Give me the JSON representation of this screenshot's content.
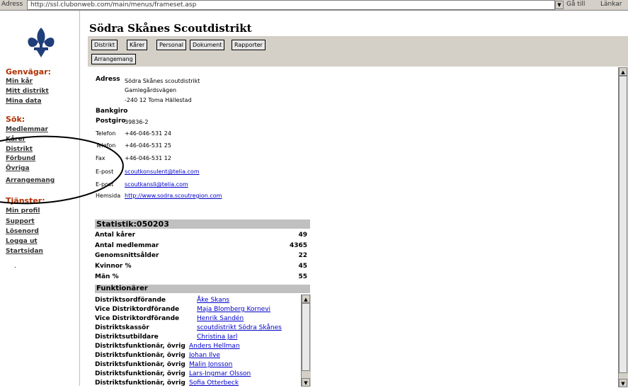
{
  "browser": {
    "address_label": "Adress",
    "url": "http://ssl.clubonweb.com/main/menus/frameset.asp",
    "go_label": "Gå till",
    "links_label": "Länkar"
  },
  "nav": {
    "shortcuts_heading": "Genvägar:",
    "shortcuts": [
      "Min kår",
      "Mitt distrikt",
      "Mina data"
    ],
    "search_heading": "Sök:",
    "search": [
      "Medlemmar",
      "Kårer",
      "Distrikt",
      "Förbund",
      "Övriga",
      "Arrangemang"
    ],
    "services_heading": "Tjänster:",
    "services": [
      "Min profil",
      "Support",
      "Lösenord",
      "Logga ut",
      "Startsidan"
    ],
    "bullet": "."
  },
  "header": {
    "title": "Södra Skånes Scoutdistrikt",
    "tabs": [
      "Distrikt",
      "Kårer",
      "Personal",
      "Dokument",
      "Rapporter",
      "Arrangemang"
    ]
  },
  "contact": {
    "address_label": "Adress",
    "address_lines": [
      "Södra Skånes scoutdistrikt",
      "Gamlegårdsvägen",
      "-240 12 Toma Hällestad"
    ],
    "bankgiro_label": "Bankgiro",
    "postgiro_label": "Postgiro",
    "postgiro_value": "39836-2",
    "phone_label": "Telefon",
    "phone1": "+46-046-531 24",
    "phone2": "+46-046-531 25",
    "fax_label": "Fax",
    "fax": "+46-046-531 12",
    "email_label": "E-post",
    "email1": "scoutkonsulent@telia.com",
    "email2": "scoutkansli@telia.com",
    "homepage_label": "Hemsida",
    "homepage": "http://www.sodra.scoutregion.com"
  },
  "statistics": {
    "heading": "Statistik:050203",
    "rows": [
      {
        "label": "Antal kårer",
        "value": "49"
      },
      {
        "label": "Antal medlemmar",
        "value": "4365"
      },
      {
        "label": "Genomsnittsålder",
        "value": "22"
      },
      {
        "label": "Kvinnor %",
        "value": "45"
      },
      {
        "label": "Män %",
        "value": "55"
      }
    ]
  },
  "officials": {
    "heading": "Funktionärer",
    "rows": [
      {
        "role": "Distriktsordförande",
        "name": "Åke Skans"
      },
      {
        "role": "Vice Distriktordförande",
        "name": "Maja Blomberg Kornevi"
      },
      {
        "role": "Vice Distriktordförande",
        "name": "Henrik Sandén"
      },
      {
        "role": "Distriktskassör",
        "name": "scoutdistrikt Södra Skånes"
      },
      {
        "role": "Distriktsutbildare",
        "name": "Christina Jarl"
      },
      {
        "role": "Distriktsfunktionär, övrig",
        "name": "Anders Hellman"
      },
      {
        "role": "Distriktsfunktionär, övrig",
        "name": "Johan Ilve"
      },
      {
        "role": "Distriktsfunktionär, övrig",
        "name": "Malin Jonsson"
      },
      {
        "role": "Distriktsfunktionär, övrig",
        "name": "Lars-Ingmar Olsson"
      },
      {
        "role": "Distriktsfunktionär, övrig",
        "name": "Sofia Otterbeck"
      }
    ]
  },
  "colors": {
    "nav_heading": "#b03000",
    "link": "#0000cc",
    "panel": "#d4d0c8",
    "section_header": "#c0c0c0"
  },
  "icons": {
    "logo": "scout-fleur-de-lis-icon",
    "scroll_up": "arrow-up-icon",
    "scroll_down": "arrow-down-icon"
  }
}
